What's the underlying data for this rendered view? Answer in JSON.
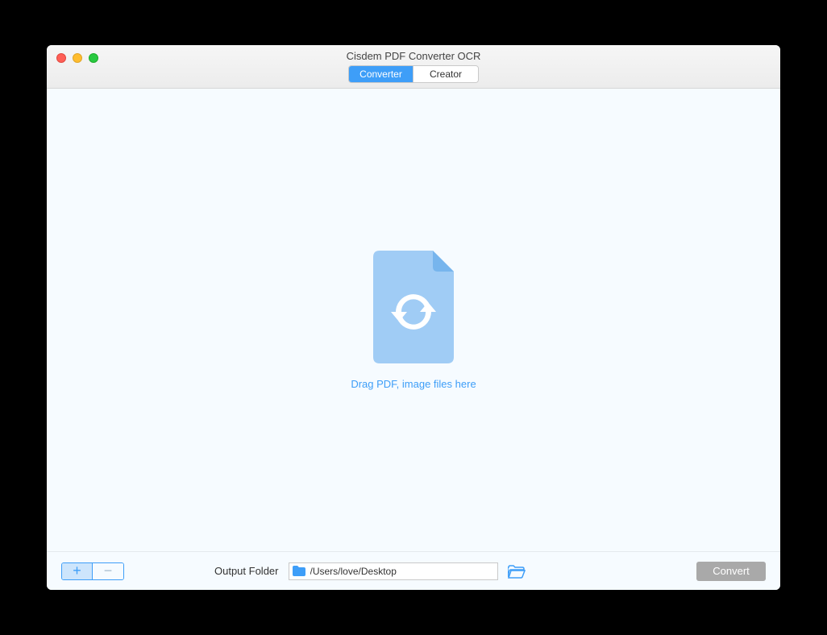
{
  "window": {
    "title": "Cisdem PDF Converter OCR"
  },
  "tabs": {
    "converter": "Converter",
    "creator": "Creator",
    "active": "converter"
  },
  "dropzone": {
    "text": "Drag PDF, image files here"
  },
  "footer": {
    "output_label": "Output Folder",
    "output_path": "/Users/love/Desktop",
    "convert_label": "Convert"
  },
  "colors": {
    "accent": "#3e9ef8",
    "accent_light": "#a0ccf5"
  }
}
